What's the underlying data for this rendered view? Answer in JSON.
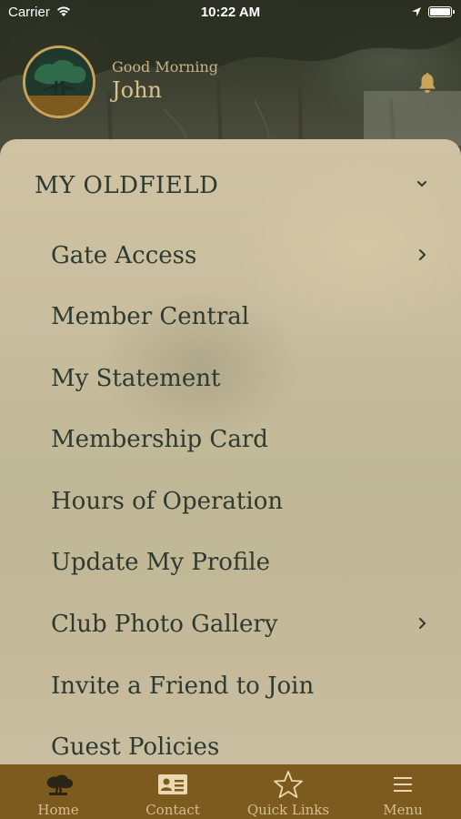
{
  "status_bar": {
    "carrier": "Carrier",
    "time": "10:22 AM"
  },
  "header": {
    "greeting": "Good Morning",
    "user_name": "John"
  },
  "menu": {
    "section_title": "MY OLDFIELD",
    "items": [
      {
        "label": "Gate Access",
        "has_submenu": true
      },
      {
        "label": "Member Central",
        "has_submenu": false
      },
      {
        "label": "My Statement",
        "has_submenu": false
      },
      {
        "label": "Membership Card",
        "has_submenu": false
      },
      {
        "label": "Hours of Operation",
        "has_submenu": false
      },
      {
        "label": "Update My Profile",
        "has_submenu": false
      },
      {
        "label": "Club Photo Gallery",
        "has_submenu": true
      },
      {
        "label": "Invite a Friend to Join",
        "has_submenu": false
      },
      {
        "label": "Guest Policies",
        "has_submenu": false
      }
    ]
  },
  "tabbar": {
    "tabs": [
      {
        "label": "Home",
        "icon": "tree-icon"
      },
      {
        "label": "Contact",
        "icon": "contact-card-icon"
      },
      {
        "label": "Quick Links",
        "icon": "star-icon"
      },
      {
        "label": "Menu",
        "icon": "hamburger-menu-icon"
      }
    ]
  },
  "colors": {
    "tabbar_bg": "#7d5a1e",
    "menu_text": "#2e3a2f",
    "logo_ring": "#c9a55a",
    "greeting_text": "#c8b485"
  }
}
